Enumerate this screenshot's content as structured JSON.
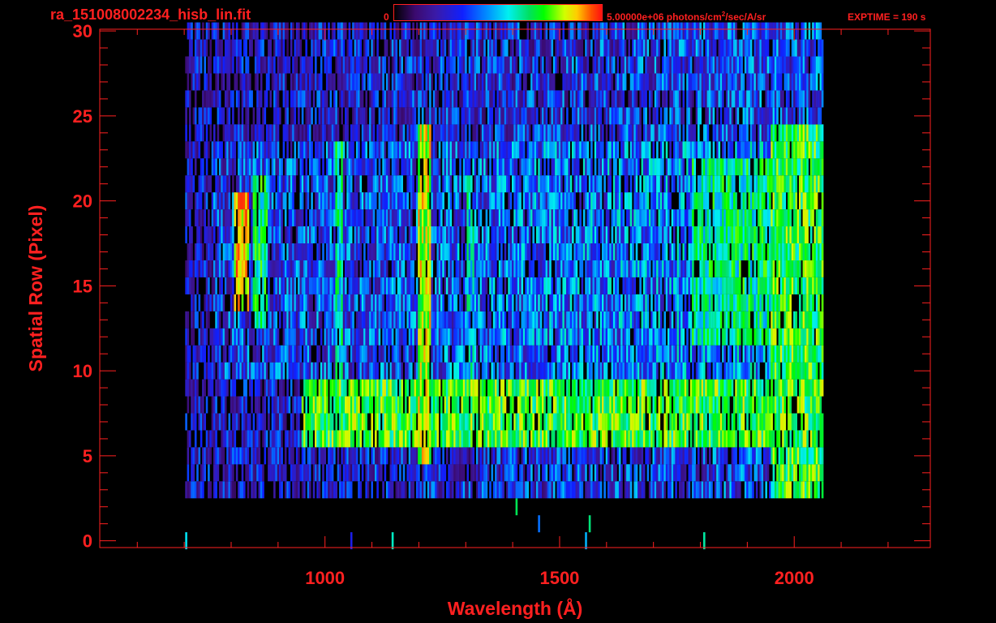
{
  "header": {
    "filename": "ra_151008002234_hisb_lin.fit",
    "colorbar_min": "0",
    "colorbar_max_value": "5.00000e+06 photons/cm",
    "colorbar_max_exp": "2",
    "colorbar_max_unit": "/sec/A/sr",
    "exptime": "EXPTIME = 190 s"
  },
  "chart_data": {
    "type": "heatmap",
    "title": "ra_151008002234_hisb_lin.fit",
    "xlabel": "Wavelength (Å)",
    "ylabel": "Spatial Row (Pixel)",
    "xlim": [
      520,
      2290
    ],
    "ylim": [
      -0.4,
      30.1
    ],
    "x_ticks": [
      1000,
      1500,
      2000
    ],
    "y_ticks": [
      0,
      5,
      10,
      15,
      20,
      25,
      30
    ],
    "x_tick_labels": [
      "1000",
      "1500",
      "2000"
    ],
    "y_tick_labels": [
      "0",
      "5",
      "10",
      "15",
      "20",
      "25",
      "30"
    ],
    "colorscale": {
      "min": 0,
      "max": 5000000,
      "unit": "photons/cm^2/sec/A/sr",
      "colors": [
        "#000000",
        "#3b0a6e",
        "#3a1aa8",
        "#1020ff",
        "#0090ff",
        "#00f0f0",
        "#00e060",
        "#00ff00",
        "#d0ff00",
        "#ffcc00",
        "#ff5000",
        "#ff1010"
      ]
    },
    "detector_range": {
      "x": [
        700,
        2060
      ],
      "rows": [
        3,
        30
      ]
    },
    "features": [
      {
        "name": "horizontal band",
        "x": [
          950,
          2060
        ],
        "rows": [
          6,
          9
        ],
        "level": 0.62
      },
      {
        "name": "vertical line",
        "x": [
          1195,
          1225
        ],
        "rows": [
          5,
          24
        ],
        "level": 0.72
      },
      {
        "name": "vertical line",
        "x": [
          1020,
          1035
        ],
        "rows": [
          10,
          23
        ],
        "level": 0.5
      },
      {
        "name": "vertical line",
        "x": [
          1300,
          1315
        ],
        "rows": [
          9,
          21
        ],
        "level": 0.45
      },
      {
        "name": "arc",
        "x": [
          805,
          835
        ],
        "rows": [
          14,
          20
        ],
        "level": 0.82
      },
      {
        "name": "arc",
        "x": [
          845,
          875
        ],
        "rows": [
          13,
          21
        ],
        "level": 0.55
      },
      {
        "name": "bright edge",
        "x": [
          1950,
          2060
        ],
        "rows": [
          3,
          24
        ],
        "level": 0.6
      },
      {
        "name": "bright region",
        "x": [
          1780,
          2060
        ],
        "rows": [
          12,
          22
        ],
        "level": 0.52
      }
    ]
  }
}
